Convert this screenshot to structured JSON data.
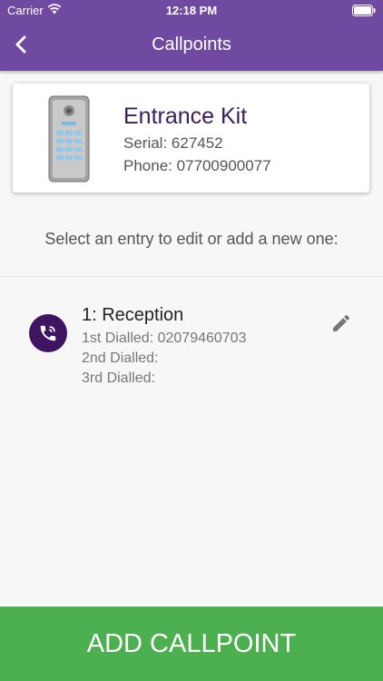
{
  "status_bar": {
    "carrier": "Carrier",
    "time": "12:18 PM"
  },
  "nav": {
    "title": "Callpoints",
    "back_icon": "chevron-left-icon"
  },
  "device": {
    "name": "Entrance Kit",
    "serial": "Serial: 627452",
    "phone": "Phone: 07700900077"
  },
  "instruction": "Select an entry to edit or add a new one:",
  "callpoints": [
    {
      "title": "1: Reception",
      "first": "1st Dialled: 02079460703",
      "second": "2nd Dialled:",
      "third": "3rd Dialled:",
      "icon": "phone-call-icon",
      "edit_icon": "pencil-icon"
    }
  ],
  "add_button_label": "ADD CALLPOINT",
  "colors": {
    "header": "#6f4aa0",
    "avatar": "#3f1460",
    "device_name": "#3b1d5e",
    "add_button": "#4caf50"
  }
}
